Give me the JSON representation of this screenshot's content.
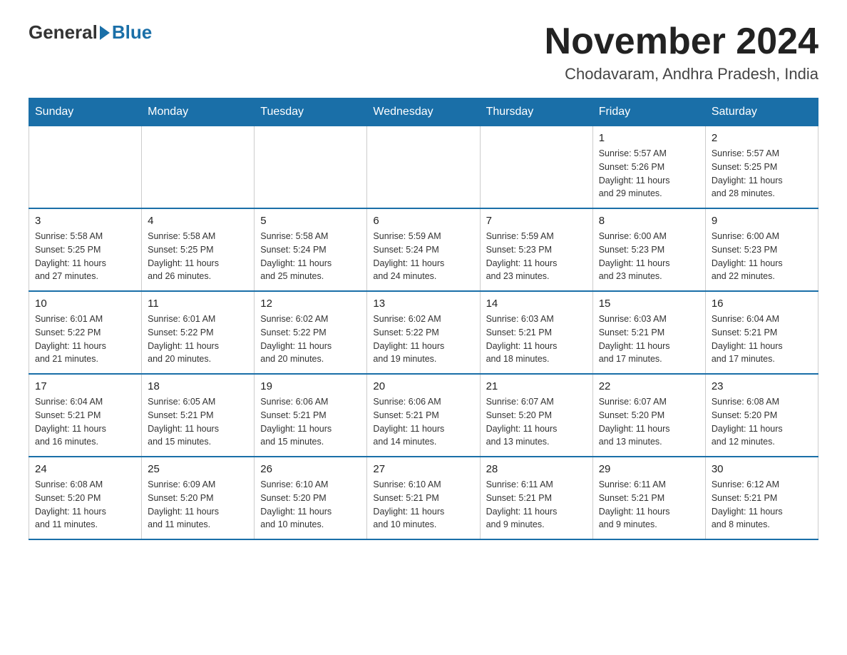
{
  "header": {
    "logo_general": "General",
    "logo_blue": "Blue",
    "month_title": "November 2024",
    "location": "Chodavaram, Andhra Pradesh, India"
  },
  "weekdays": [
    "Sunday",
    "Monday",
    "Tuesday",
    "Wednesday",
    "Thursday",
    "Friday",
    "Saturday"
  ],
  "weeks": [
    [
      {
        "day": "",
        "info": ""
      },
      {
        "day": "",
        "info": ""
      },
      {
        "day": "",
        "info": ""
      },
      {
        "day": "",
        "info": ""
      },
      {
        "day": "",
        "info": ""
      },
      {
        "day": "1",
        "info": "Sunrise: 5:57 AM\nSunset: 5:26 PM\nDaylight: 11 hours\nand 29 minutes."
      },
      {
        "day": "2",
        "info": "Sunrise: 5:57 AM\nSunset: 5:25 PM\nDaylight: 11 hours\nand 28 minutes."
      }
    ],
    [
      {
        "day": "3",
        "info": "Sunrise: 5:58 AM\nSunset: 5:25 PM\nDaylight: 11 hours\nand 27 minutes."
      },
      {
        "day": "4",
        "info": "Sunrise: 5:58 AM\nSunset: 5:25 PM\nDaylight: 11 hours\nand 26 minutes."
      },
      {
        "day": "5",
        "info": "Sunrise: 5:58 AM\nSunset: 5:24 PM\nDaylight: 11 hours\nand 25 minutes."
      },
      {
        "day": "6",
        "info": "Sunrise: 5:59 AM\nSunset: 5:24 PM\nDaylight: 11 hours\nand 24 minutes."
      },
      {
        "day": "7",
        "info": "Sunrise: 5:59 AM\nSunset: 5:23 PM\nDaylight: 11 hours\nand 23 minutes."
      },
      {
        "day": "8",
        "info": "Sunrise: 6:00 AM\nSunset: 5:23 PM\nDaylight: 11 hours\nand 23 minutes."
      },
      {
        "day": "9",
        "info": "Sunrise: 6:00 AM\nSunset: 5:23 PM\nDaylight: 11 hours\nand 22 minutes."
      }
    ],
    [
      {
        "day": "10",
        "info": "Sunrise: 6:01 AM\nSunset: 5:22 PM\nDaylight: 11 hours\nand 21 minutes."
      },
      {
        "day": "11",
        "info": "Sunrise: 6:01 AM\nSunset: 5:22 PM\nDaylight: 11 hours\nand 20 minutes."
      },
      {
        "day": "12",
        "info": "Sunrise: 6:02 AM\nSunset: 5:22 PM\nDaylight: 11 hours\nand 20 minutes."
      },
      {
        "day": "13",
        "info": "Sunrise: 6:02 AM\nSunset: 5:22 PM\nDaylight: 11 hours\nand 19 minutes."
      },
      {
        "day": "14",
        "info": "Sunrise: 6:03 AM\nSunset: 5:21 PM\nDaylight: 11 hours\nand 18 minutes."
      },
      {
        "day": "15",
        "info": "Sunrise: 6:03 AM\nSunset: 5:21 PM\nDaylight: 11 hours\nand 17 minutes."
      },
      {
        "day": "16",
        "info": "Sunrise: 6:04 AM\nSunset: 5:21 PM\nDaylight: 11 hours\nand 17 minutes."
      }
    ],
    [
      {
        "day": "17",
        "info": "Sunrise: 6:04 AM\nSunset: 5:21 PM\nDaylight: 11 hours\nand 16 minutes."
      },
      {
        "day": "18",
        "info": "Sunrise: 6:05 AM\nSunset: 5:21 PM\nDaylight: 11 hours\nand 15 minutes."
      },
      {
        "day": "19",
        "info": "Sunrise: 6:06 AM\nSunset: 5:21 PM\nDaylight: 11 hours\nand 15 minutes."
      },
      {
        "day": "20",
        "info": "Sunrise: 6:06 AM\nSunset: 5:21 PM\nDaylight: 11 hours\nand 14 minutes."
      },
      {
        "day": "21",
        "info": "Sunrise: 6:07 AM\nSunset: 5:20 PM\nDaylight: 11 hours\nand 13 minutes."
      },
      {
        "day": "22",
        "info": "Sunrise: 6:07 AM\nSunset: 5:20 PM\nDaylight: 11 hours\nand 13 minutes."
      },
      {
        "day": "23",
        "info": "Sunrise: 6:08 AM\nSunset: 5:20 PM\nDaylight: 11 hours\nand 12 minutes."
      }
    ],
    [
      {
        "day": "24",
        "info": "Sunrise: 6:08 AM\nSunset: 5:20 PM\nDaylight: 11 hours\nand 11 minutes."
      },
      {
        "day": "25",
        "info": "Sunrise: 6:09 AM\nSunset: 5:20 PM\nDaylight: 11 hours\nand 11 minutes."
      },
      {
        "day": "26",
        "info": "Sunrise: 6:10 AM\nSunset: 5:20 PM\nDaylight: 11 hours\nand 10 minutes."
      },
      {
        "day": "27",
        "info": "Sunrise: 6:10 AM\nSunset: 5:21 PM\nDaylight: 11 hours\nand 10 minutes."
      },
      {
        "day": "28",
        "info": "Sunrise: 6:11 AM\nSunset: 5:21 PM\nDaylight: 11 hours\nand 9 minutes."
      },
      {
        "day": "29",
        "info": "Sunrise: 6:11 AM\nSunset: 5:21 PM\nDaylight: 11 hours\nand 9 minutes."
      },
      {
        "day": "30",
        "info": "Sunrise: 6:12 AM\nSunset: 5:21 PM\nDaylight: 11 hours\nand 8 minutes."
      }
    ]
  ]
}
